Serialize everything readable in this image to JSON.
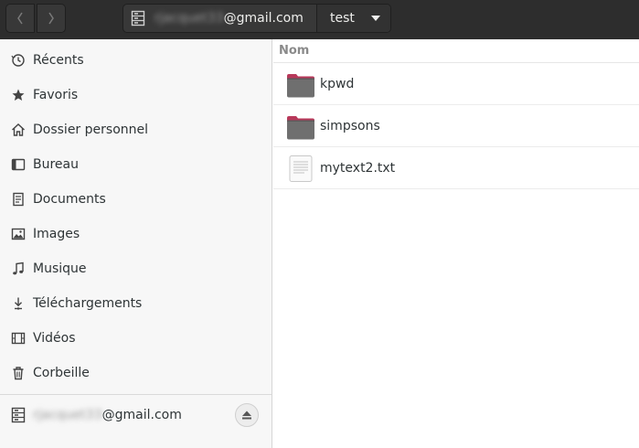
{
  "header": {
    "back_icon": "chevron-left-icon",
    "forward_icon": "chevron-right-icon",
    "path_root_user": "rjacquet33",
    "path_root_domain": "@gmail.com",
    "path_current": "test"
  },
  "sidebar": {
    "items": [
      {
        "label": "Récents",
        "icon": "clock-icon"
      },
      {
        "label": "Favoris",
        "icon": "star-icon"
      },
      {
        "label": "Dossier personnel",
        "icon": "home-icon"
      },
      {
        "label": "Bureau",
        "icon": "desktop-icon"
      },
      {
        "label": "Documents",
        "icon": "document-icon"
      },
      {
        "label": "Images",
        "icon": "image-icon"
      },
      {
        "label": "Musique",
        "icon": "music-icon"
      },
      {
        "label": "Téléchargements",
        "icon": "download-icon"
      },
      {
        "label": "Vidéos",
        "icon": "film-icon"
      },
      {
        "label": "Corbeille",
        "icon": "trash-icon"
      }
    ],
    "mount": {
      "user": "rjacquet33",
      "domain": "@gmail.com",
      "icon": "drive-icon",
      "eject_icon": "eject-icon"
    }
  },
  "files": {
    "column_name": "Nom",
    "rows": [
      {
        "name": "kpwd",
        "type": "folder"
      },
      {
        "name": "simpsons",
        "type": "folder"
      },
      {
        "name": "mytext2.txt",
        "type": "text"
      }
    ]
  },
  "colors": {
    "headerbar": "#2d2d2d",
    "folder_body": "#6f6f6f",
    "folder_tab": "#b8385a",
    "sidebar_bg": "#f7f7f7"
  }
}
